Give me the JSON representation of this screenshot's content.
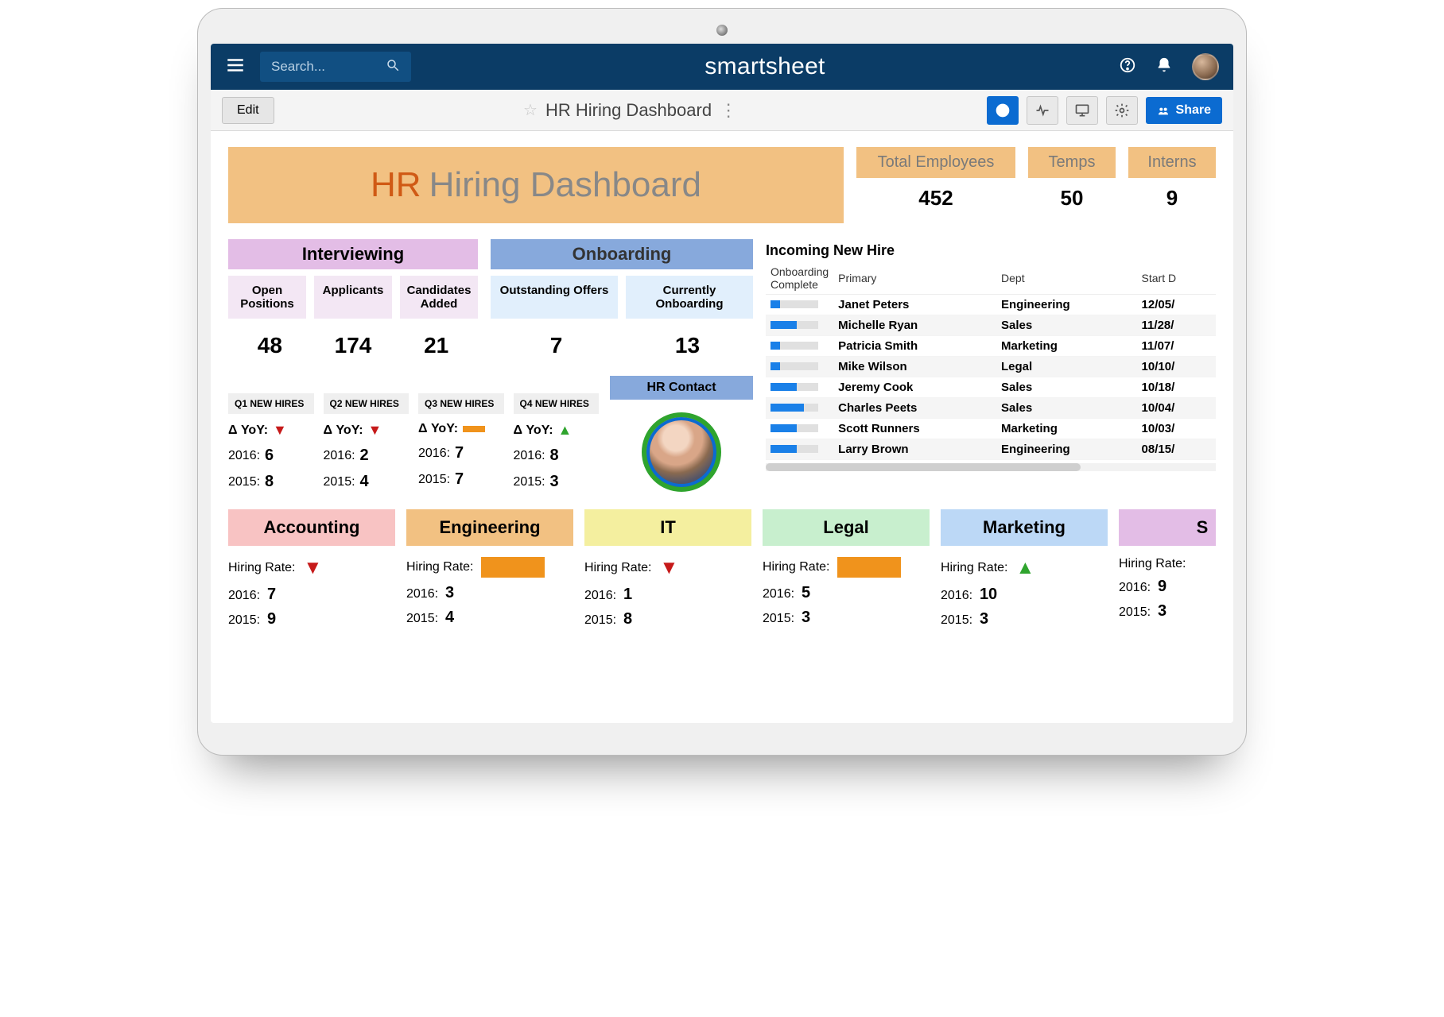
{
  "app": {
    "brand": "smartsheet",
    "search_placeholder": "Search..."
  },
  "toolbar": {
    "edit": "Edit",
    "title": "HR Hiring Dashboard",
    "share": "Share"
  },
  "hero": {
    "hr": "HR",
    "rest": "Hiring Dashboard"
  },
  "stats": {
    "total_label": "Total Employees",
    "total_value": "452",
    "temps_label": "Temps",
    "temps_value": "50",
    "interns_label": "Interns",
    "interns_value": "9"
  },
  "sections": {
    "interviewing": "Interviewing",
    "onboarding": "Onboarding",
    "hr_contact": "HR Contact",
    "pills": {
      "open": "Open Positions",
      "applicants": "Applicants",
      "cand": "Candidates Added",
      "offers": "Outstanding Offers",
      "onboard": "Currently Onboarding"
    },
    "nums": {
      "open": "48",
      "applicants": "174",
      "cand": "21",
      "offers": "7",
      "onboard": "13"
    }
  },
  "quarters": [
    {
      "h": "Q1 NEW HIRES",
      "trend": "down",
      "y16": "6",
      "y15": "8"
    },
    {
      "h": "Q2 NEW HIRES",
      "trend": "down",
      "y16": "2",
      "y15": "4"
    },
    {
      "h": "Q3 NEW HIRES",
      "trend": "flat",
      "y16": "7",
      "y15": "7"
    },
    {
      "h": "Q4 NEW HIRES",
      "trend": "up",
      "y16": "8",
      "y15": "3"
    }
  ],
  "labels": {
    "delta": "Δ YoY:",
    "y2016": "2016:",
    "y2015": "2015:",
    "hrate": "Hiring Rate:"
  },
  "new_hires": {
    "title": "Incoming New Hire",
    "cols": {
      "c1": "Onboarding Complete",
      "c2": "Primary",
      "c3": "Dept",
      "c4": "Start D"
    },
    "rows": [
      {
        "p": 20,
        "name": "Janet Peters",
        "dept": "Engineering",
        "date": "12/05/"
      },
      {
        "p": 55,
        "name": "Michelle Ryan",
        "dept": "Sales",
        "date": "11/28/"
      },
      {
        "p": 20,
        "name": "Patricia Smith",
        "dept": "Marketing",
        "date": "11/07/"
      },
      {
        "p": 20,
        "name": "Mike Wilson",
        "dept": "Legal",
        "date": "10/10/"
      },
      {
        "p": 55,
        "name": "Jeremy Cook",
        "dept": "Sales",
        "date": "10/18/"
      },
      {
        "p": 70,
        "name": "Charles Peets",
        "dept": "Sales",
        "date": "10/04/"
      },
      {
        "p": 55,
        "name": "Scott Runners",
        "dept": "Marketing",
        "date": "10/03/"
      },
      {
        "p": 55,
        "name": "Larry Brown",
        "dept": "Engineering",
        "date": "08/15/"
      }
    ]
  },
  "depts": [
    {
      "name": "Accounting",
      "cls": "c-acc",
      "trend": "down",
      "y16": "7",
      "y15": "9"
    },
    {
      "name": "Engineering",
      "cls": "c-eng",
      "trend": "flat",
      "y16": "3",
      "y15": "4"
    },
    {
      "name": "IT",
      "cls": "c-it",
      "trend": "down",
      "y16": "1",
      "y15": "8"
    },
    {
      "name": "Legal",
      "cls": "c-leg",
      "trend": "flat",
      "y16": "5",
      "y15": "3"
    },
    {
      "name": "Marketing",
      "cls": "c-mkt",
      "trend": "up",
      "y16": "10",
      "y15": "3"
    },
    {
      "name": "S",
      "cls": "c-sal",
      "trend": "none",
      "y16": "9",
      "y15": "3"
    }
  ]
}
